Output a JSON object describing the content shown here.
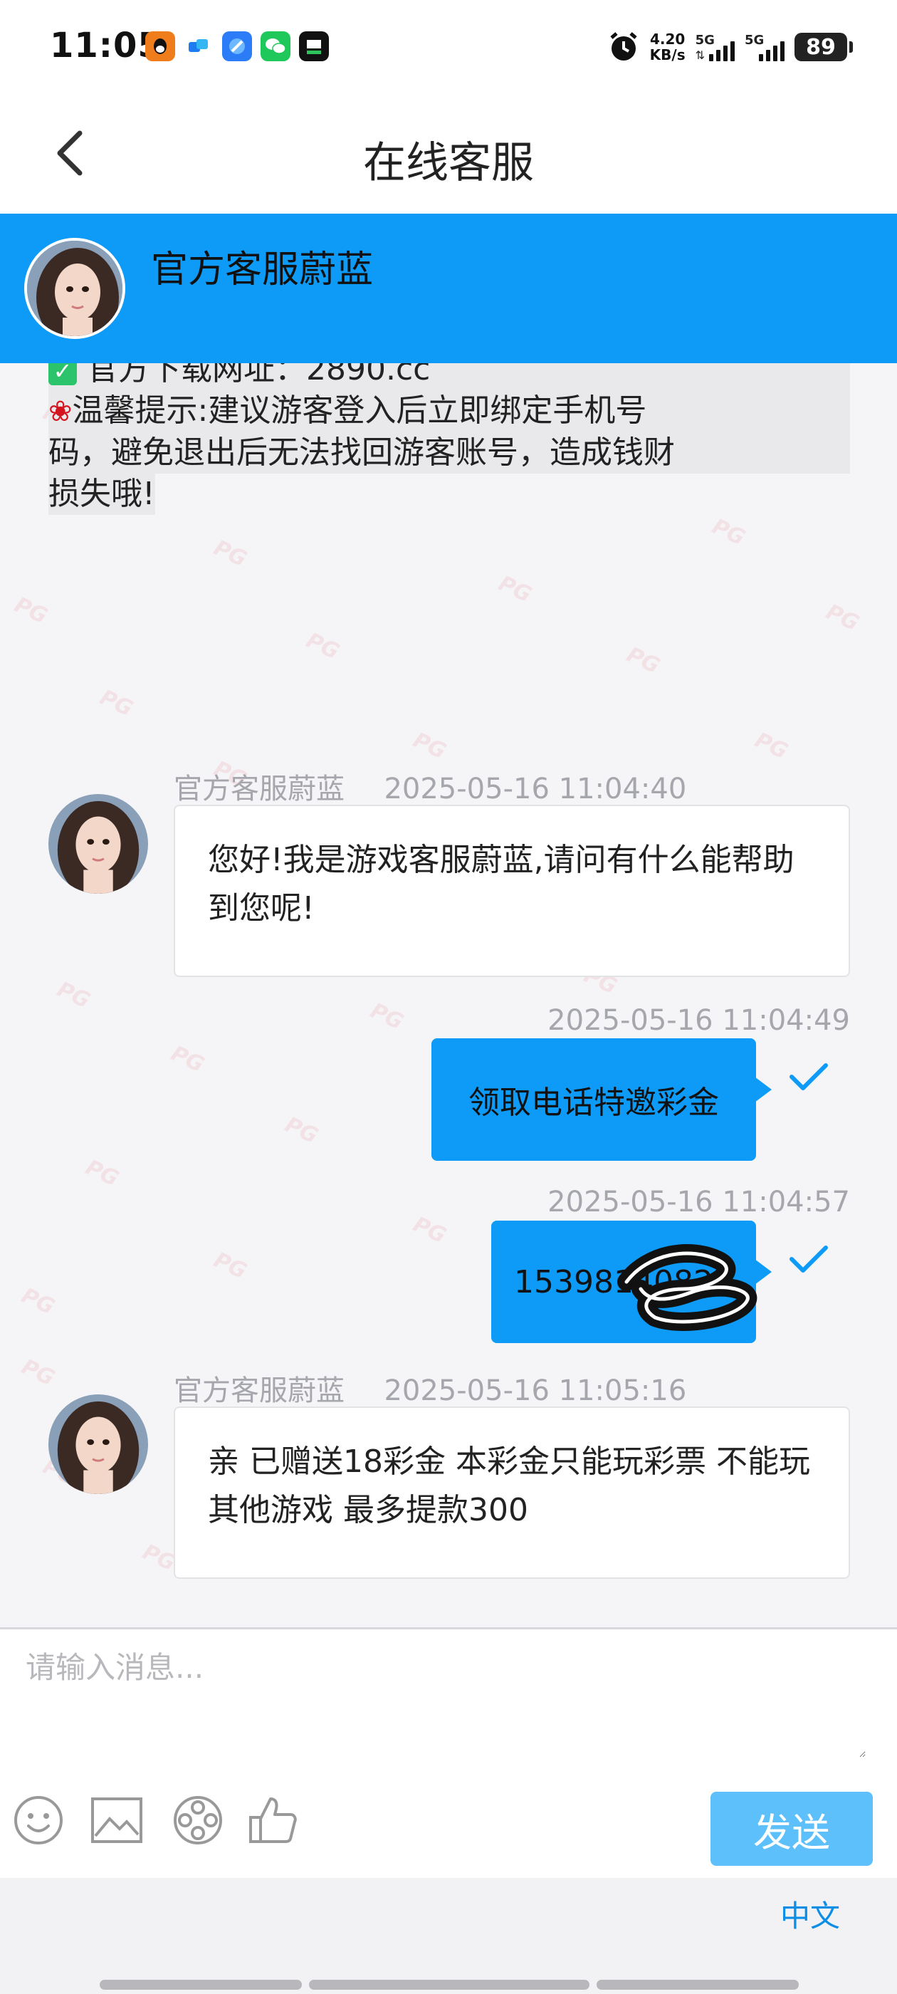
{
  "status_bar": {
    "time": "11:05",
    "net_speed_value": "4.20",
    "net_speed_unit": "KB/s",
    "signal1_label": "5G",
    "signal2_label": "5G",
    "battery": "89",
    "notification_icons": [
      "qq-icon",
      "feishu-icon",
      "browser-icon",
      "wechat-icon",
      "app-icon"
    ]
  },
  "nav": {
    "title": "在线客服"
  },
  "agent_banner": {
    "name": "官方客服蔚蓝"
  },
  "notice": {
    "line1": "官方下载网址：2890.cc",
    "line2": "温馨提示:建议游客登入后立即绑定手机号",
    "line3": "码，避免退出后无法找回游客账号，造成钱财",
    "line4": "损失哦!"
  },
  "messages": [
    {
      "direction": "in",
      "sender": "官方客服蔚蓝",
      "time": "2025-05-16 11:04:40",
      "text": "您好!我是游戏客服蔚蓝,请问有什么能帮助到您呢!"
    },
    {
      "direction": "out",
      "time": "2025-05-16 11:04:49",
      "text": "领取电话特邀彩金",
      "read": true
    },
    {
      "direction": "out",
      "time": "2025-05-16 11:04:57",
      "text": "15398140820",
      "read": true
    },
    {
      "direction": "in",
      "sender": "官方客服蔚蓝",
      "time": "2025-05-16 11:05:16",
      "text": "亲 已赠送18彩金 本彩金只能玩彩票 不能玩其他游戏  最多提款300"
    }
  ],
  "input": {
    "placeholder": "请输入消息...",
    "value": ""
  },
  "toolbar": {
    "icons": [
      "emoji-icon",
      "image-icon",
      "video-icon",
      "thumbs-up-icon"
    ],
    "send_label": "发送"
  },
  "footer": {
    "language": "中文"
  },
  "colors": {
    "accent": "#0d9bf7",
    "send_button": "#5ec0fb",
    "link": "#0d8ee6"
  }
}
